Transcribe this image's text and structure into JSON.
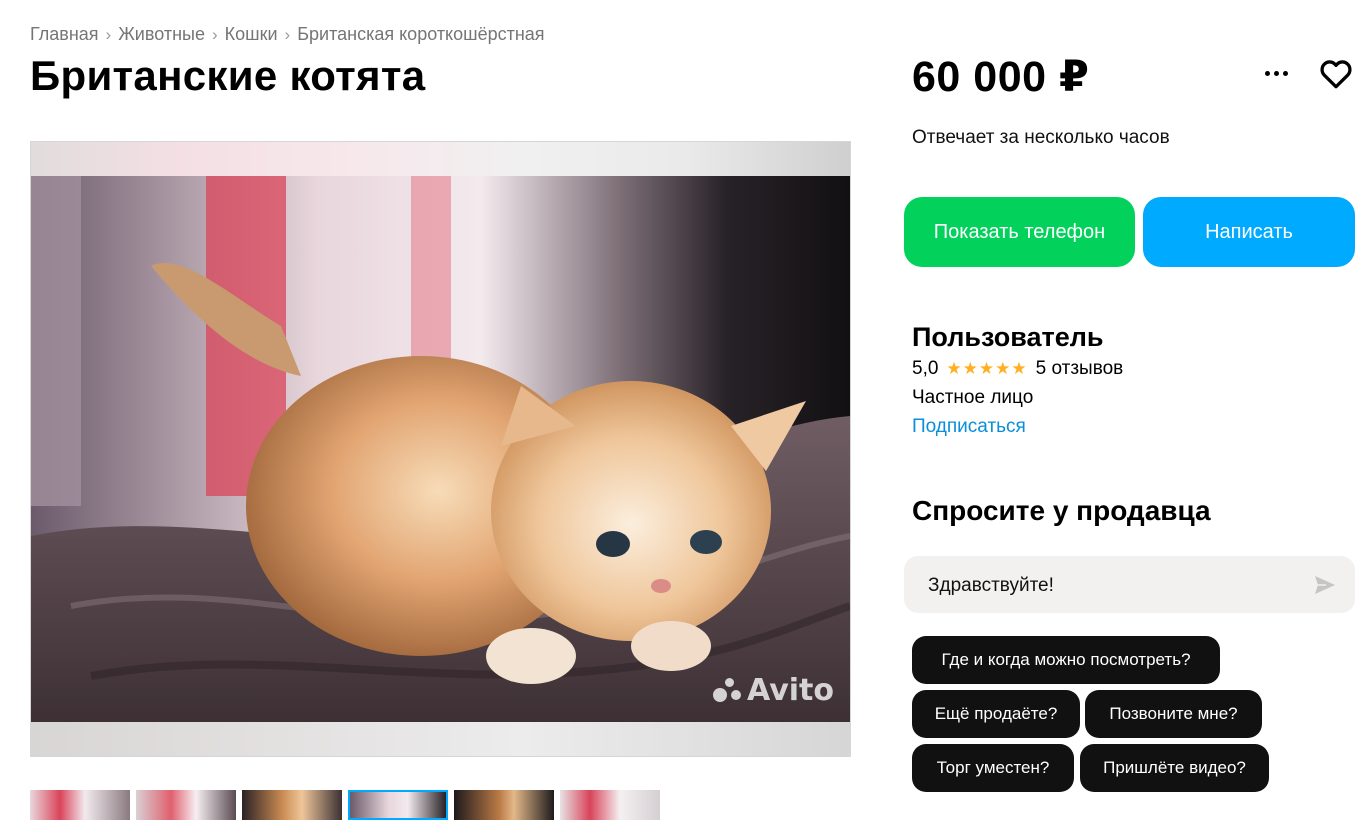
{
  "breadcrumb": [
    {
      "label": "Главная"
    },
    {
      "label": "Животные"
    },
    {
      "label": "Кошки"
    },
    {
      "label": "Британская короткошёрстная"
    }
  ],
  "breadcrumb_separator": "›",
  "listing": {
    "title": "Британские котята",
    "price": "60 000 ₽",
    "response_time": "Отвечает за несколько часов"
  },
  "gallery": {
    "watermark": "Avito",
    "thumbnail_count": 6,
    "active_thumbnail": 4
  },
  "actions": {
    "phone_label": "Показать телефон",
    "write_label": "Написать",
    "more_icon": "more-dots-icon",
    "favorite_icon": "heart-icon"
  },
  "seller": {
    "name": "Пользователь",
    "rating": "5,0",
    "stars": 5,
    "stars_text": "★★★★★",
    "reviews": "5 отзывов",
    "type": "Частное лицо",
    "subscribe_label": "Подписаться"
  },
  "ask": {
    "title": "Спросите у продавца",
    "input_value": "Здравствуйте!",
    "send_icon": "send-arrow-icon",
    "chips": [
      "Где и когда можно посмотреть?",
      "Ещё продаёте?",
      "Позвоните мне?",
      "Торг уместен?",
      "Пришлёте видео?"
    ]
  },
  "colors": {
    "phone_button": "#02d15c",
    "write_button": "#00aaff",
    "link": "#0a8edc",
    "stars": "#ffb021",
    "chip": "#111111"
  }
}
